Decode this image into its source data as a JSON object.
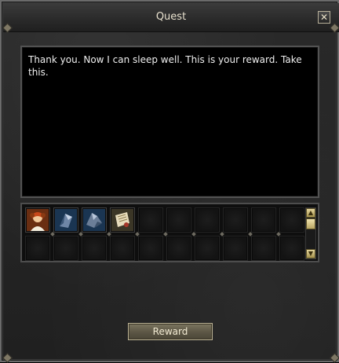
{
  "window": {
    "title": "Quest",
    "close_label": "✕"
  },
  "dialog": {
    "message": "Thank you. Now I can sleep well. This is your reward. Take this."
  },
  "rewards": {
    "items": [
      {
        "icon": "character-portrait-icon"
      },
      {
        "icon": "blue-gem-chip-icon"
      },
      {
        "icon": "blue-gem-shard-icon"
      },
      {
        "icon": "scroll-document-icon"
      }
    ],
    "scroll_up_label": "▲",
    "scroll_down_label": "▼"
  },
  "actions": {
    "reward_label": "Reward"
  },
  "colors": {
    "frame_border": "#6b6b6b",
    "title_text": "#e9e2cf",
    "button_face": "#5e5847",
    "button_border": "#bcb395",
    "scroll_accent": "#e7d89e"
  }
}
